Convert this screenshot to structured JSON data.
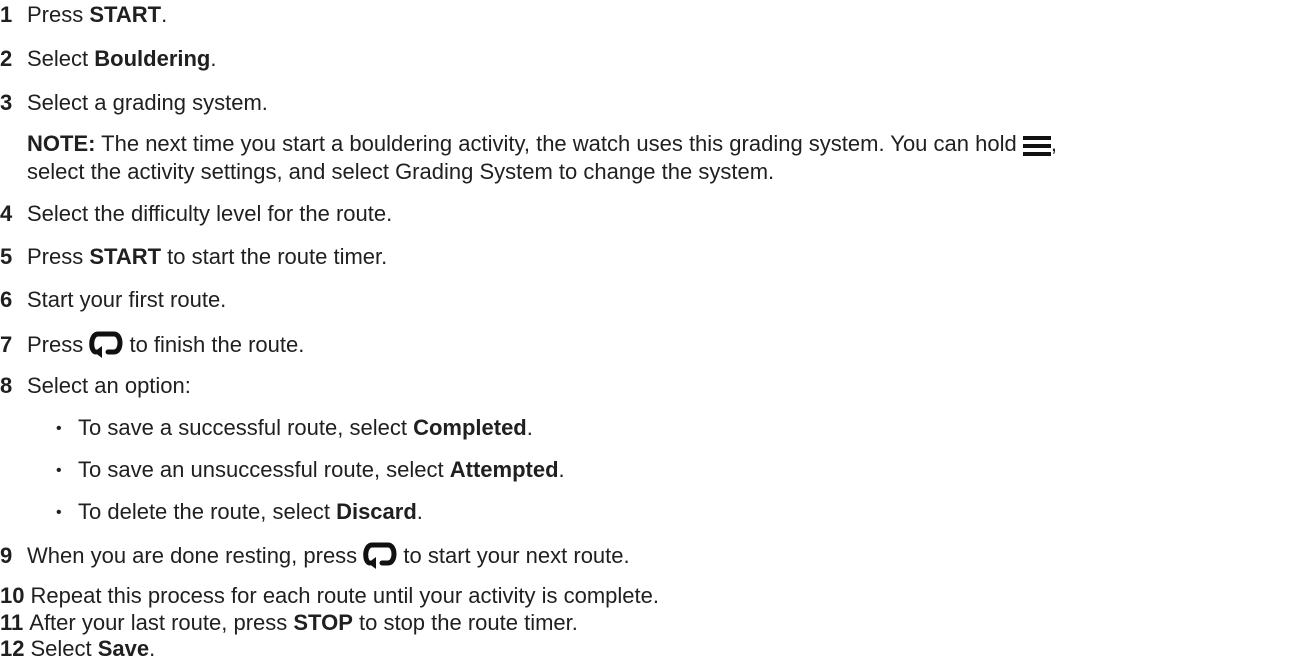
{
  "steps": [
    {
      "num": "1",
      "pre": "Press ",
      "bold": "START",
      "post": "."
    },
    {
      "num": "2",
      "pre": "Select ",
      "bold": "Bouldering",
      "post": "."
    },
    {
      "num": "3",
      "text": "Select a grading system."
    },
    {
      "num": "4",
      "text": "Select the difficulty level for the route."
    },
    {
      "num": "5",
      "pre": "Press ",
      "bold": "START",
      "post": " to start the route timer."
    },
    {
      "num": "6",
      "text": "Start your first route."
    },
    {
      "num": "7",
      "pre": "Press ",
      "post": " to finish the route."
    },
    {
      "num": "8",
      "text": "Select an option:"
    },
    {
      "num": "9",
      "pre": "When you are done resting, press ",
      "post": " to start your next route."
    },
    {
      "num": "10",
      "text": "Repeat this process for each route until your activity is complete."
    },
    {
      "num": "11",
      "pre": "After your last route, press ",
      "bold": "STOP",
      "post": " to stop the route timer."
    },
    {
      "num": "12",
      "pre": "Select ",
      "bold": "Save",
      "post": "."
    }
  ],
  "note": {
    "label": "NOTE:",
    "line1": " The next time you start a bouldering activity, the watch uses this grading system. You can hold ",
    "line1_end": ",",
    "line2": "select the activity settings, and select Grading System to change the system."
  },
  "bullets": [
    {
      "pre": "To save a successful route, select ",
      "bold": "Completed",
      "post": "."
    },
    {
      "pre": "To save an unsuccessful route, select ",
      "bold": "Attempted",
      "post": "."
    },
    {
      "pre": "To delete the route, select ",
      "bold": "Discard",
      "post": "."
    }
  ],
  "bullet_char": "•",
  "icons": {
    "menu": "menu-icon",
    "lap": "lap-icon"
  }
}
